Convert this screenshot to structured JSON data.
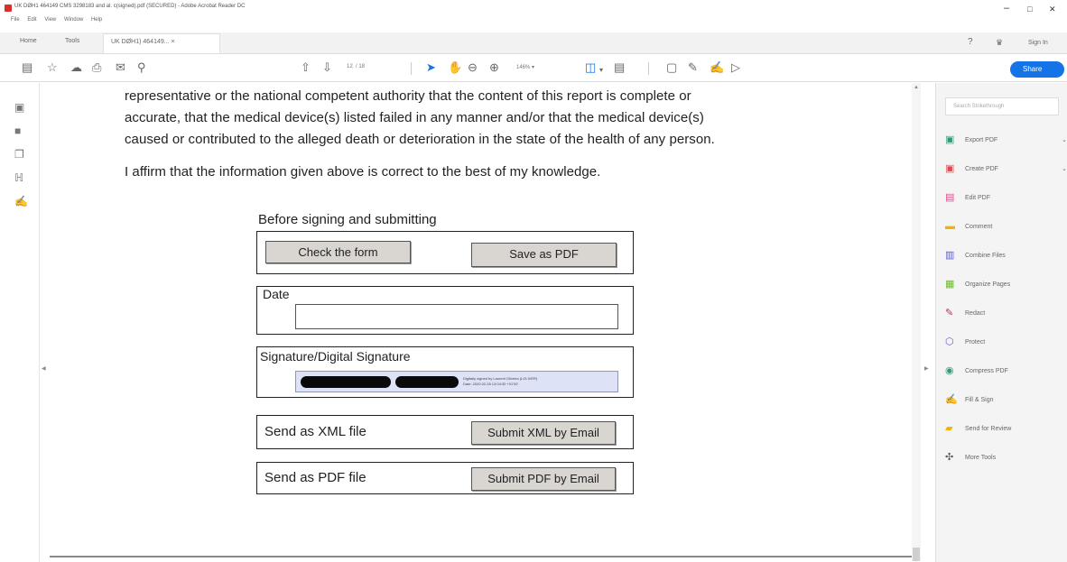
{
  "window": {
    "title": "UK DØH1 464149 CMS 3298183 and al. c(signed).pdf (SECURED) - Adobe Acrobat Reader DC",
    "menu": [
      "File",
      "Edit",
      "View",
      "Window",
      "Help"
    ],
    "controls": {
      "minimize": "–",
      "maximize": "□",
      "close": "✕"
    }
  },
  "tabs": {
    "home": "Home",
    "tools": "Tools",
    "document": "UK DØH1) 464149...  ×"
  },
  "top_right": {
    "help_icon": "?",
    "bell_icon": "bell",
    "sign_in": "Sign In"
  },
  "toolbar": {
    "page_current": "12",
    "page_total": "/ 18",
    "zoom": "146%  ▾",
    "share_label": "Share"
  },
  "document": {
    "lines": [
      "representative or the national competent authority that the content of this report is complete or",
      "accurate, that the medical device(s) listed failed in any manner and/or that the medical device(s)",
      "caused or contributed to the alleged death or deterioration in the state of the health of any person."
    ],
    "affirm": "I affirm that the information given above is correct to the best of my knowledge."
  },
  "form": {
    "before_signing": "Before signing and submitting",
    "check_form": "Check the form",
    "save_pdf": "Save as PDF",
    "date_label": "Date",
    "date_value": "",
    "signature_label": "Signature/Digital Signature",
    "sig_line1": "Digitally signed by Laurent Oliveira (LOLIVER)",
    "sig_line2": "Date: 2020.02.28 13:04:30 +01'00'",
    "xml_label": "Send as XML file",
    "xml_button": "Submit XML by Email",
    "pdf_label": "Send as PDF file",
    "pdf_button": "Submit PDF by Email"
  },
  "right_panel": {
    "search_placeholder": "Search Strikethrough",
    "items": [
      {
        "label": "Export PDF",
        "icon": "export-pdf-icon",
        "color": "#2d9d78",
        "chevron": true
      },
      {
        "label": "Create PDF",
        "icon": "create-pdf-icon",
        "color": "#e34850",
        "chevron": true
      },
      {
        "label": "Edit PDF",
        "icon": "edit-pdf-icon",
        "color": "#e34890",
        "chevron": false
      },
      {
        "label": "Comment",
        "icon": "comment-icon",
        "color": "#f0b400",
        "chevron": false
      },
      {
        "label": "Combine Files",
        "icon": "combine-files-icon",
        "color": "#5b5bd6",
        "chevron": false
      },
      {
        "label": "Organize Pages",
        "icon": "organize-pages-icon",
        "color": "#6bbd27",
        "chevron": false
      },
      {
        "label": "Redact",
        "icon": "redact-icon",
        "color": "#b0306b",
        "chevron": false
      },
      {
        "label": "Protect",
        "icon": "protect-icon",
        "color": "#6666cc",
        "chevron": false
      },
      {
        "label": "Compress PDF",
        "icon": "compress-pdf-icon",
        "color": "#2d9d78",
        "chevron": false
      },
      {
        "label": "Fill & Sign",
        "icon": "fill-sign-icon",
        "color": "#7a4bd6",
        "chevron": false
      },
      {
        "label": "Send for Review",
        "icon": "send-review-icon",
        "color": "#f0b400",
        "chevron": false
      },
      {
        "label": "More Tools",
        "icon": "more-tools-icon",
        "color": "#555555",
        "chevron": false
      }
    ]
  }
}
